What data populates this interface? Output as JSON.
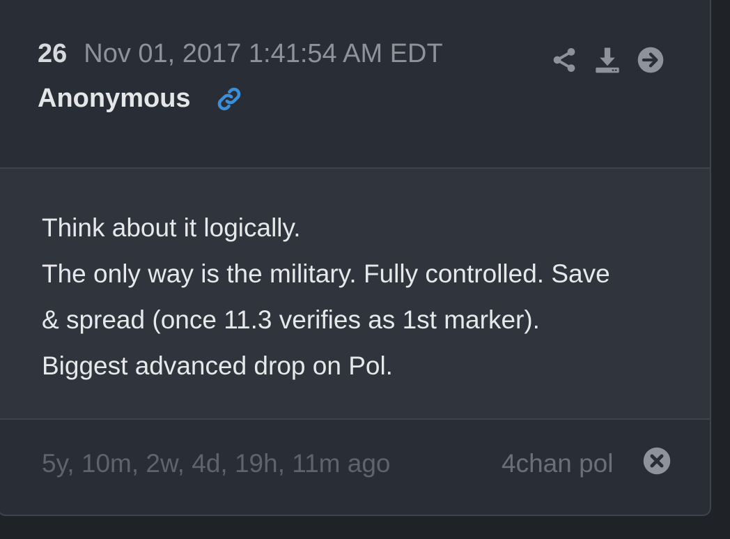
{
  "post": {
    "number": "26",
    "date": "Nov 01, 2017 1:41:54 AM EDT",
    "author": "Anonymous",
    "body_lines": [
      "Think about it logically.",
      "The only way is the military. Fully controlled. Save",
      "& spread (once 11.3 verifies as 1st marker).",
      "Biggest advanced drop on Pol."
    ],
    "age": "5y, 10m, 2w, 4d, 19h, 11m ago",
    "source": "4chan pol"
  },
  "icons": {
    "link": "link-icon",
    "share": "share-icon",
    "download": "download-icon",
    "go": "arrow-right-circle-icon",
    "close": "close-circle-icon"
  },
  "colors": {
    "link_accent": "#3b8ed8",
    "icon_gray": "#8e929a"
  }
}
